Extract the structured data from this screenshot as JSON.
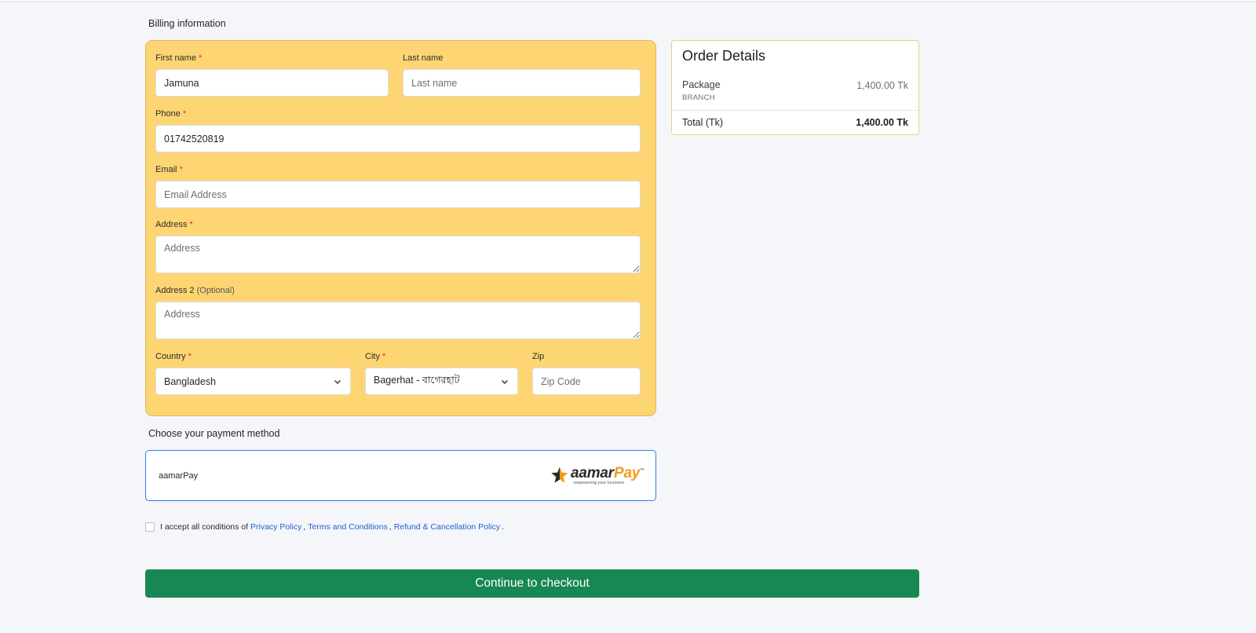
{
  "billing": {
    "title": "Billing information",
    "first_name": {
      "label": "First name",
      "required": "*",
      "value": "Jamuna",
      "placeholder": "First name"
    },
    "last_name": {
      "label": "Last name",
      "value": "",
      "placeholder": "Last name"
    },
    "phone": {
      "label": "Phone",
      "required": "*",
      "value": "01742520819",
      "placeholder": "Phone"
    },
    "email": {
      "label": "Email",
      "required": "*",
      "value": "",
      "placeholder": "Email Address"
    },
    "address": {
      "label": "Address",
      "required": "*",
      "value": "",
      "placeholder": "Address"
    },
    "address2": {
      "label": "Address 2",
      "optional": "(Optional)",
      "value": "",
      "placeholder": "Address"
    },
    "country": {
      "label": "Country",
      "required": "*",
      "value": "Bangladesh"
    },
    "city": {
      "label": "City",
      "required": "*",
      "value": "Bagerhat - বাগেরহাট"
    },
    "zip": {
      "label": "Zip",
      "value": "",
      "placeholder": "Zip Code"
    }
  },
  "order": {
    "title": "Order Details",
    "package_label": "Package",
    "package_type": "BRANCH",
    "package_price": "1,400.00 Tk",
    "total_label": "Total (Tk)",
    "total_value": "1,400.00 Tk"
  },
  "payment": {
    "title": "Choose your payment method",
    "method_name": "aamarPay",
    "logo_part1": "aamar",
    "logo_part2": "Pay",
    "logo_tm": "™",
    "logo_tagline": "empowering your business",
    "brand_color": "#f29a1b"
  },
  "consent": {
    "prefix": "I accept all conditions of",
    "privacy": "Privacy Policy",
    "sep1": ",",
    "terms": "Terms and Conditions",
    "sep2": ",",
    "refund": "Refund & Cancellation Policy",
    "suffix": "."
  },
  "checkout": {
    "label": "Continue to checkout",
    "color": "#178753"
  }
}
